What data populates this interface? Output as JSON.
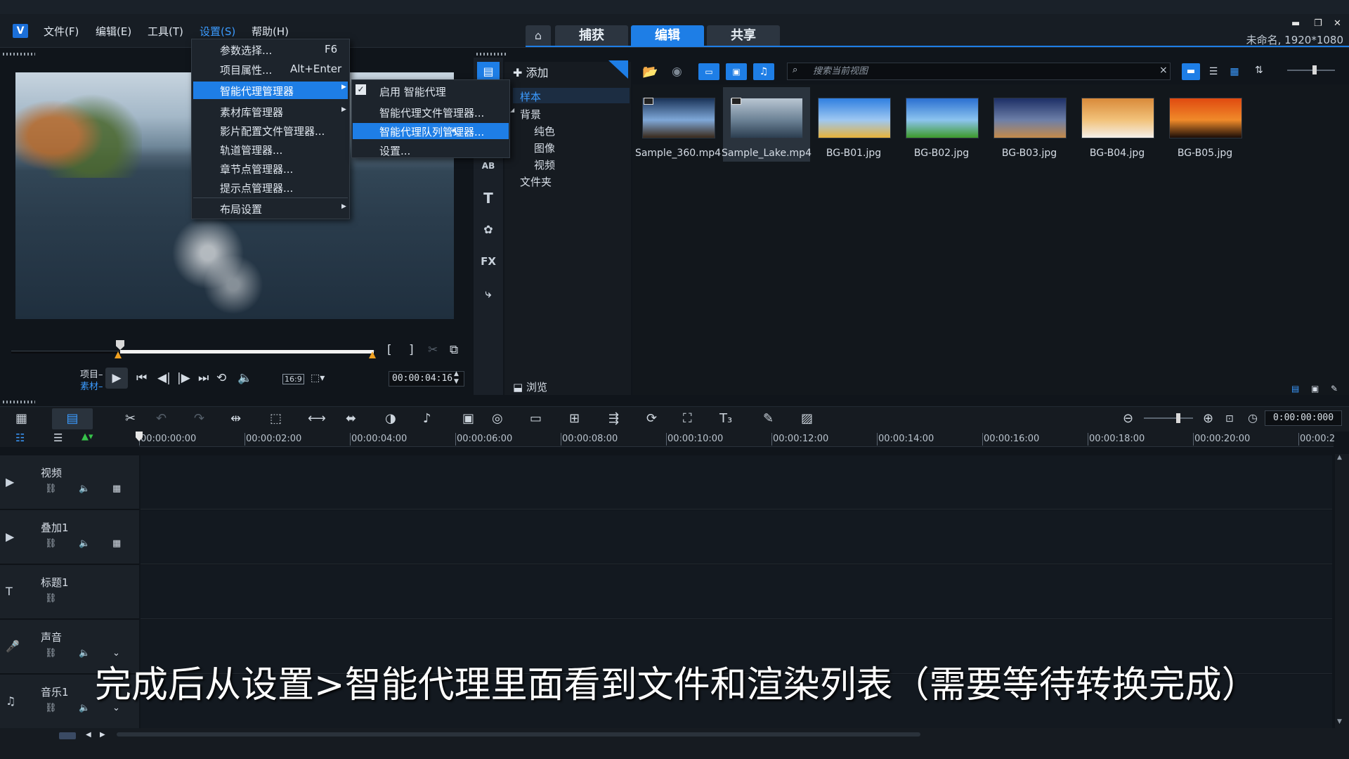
{
  "app": {
    "logo_label": "V",
    "project_info": "未命名, 1920*1080"
  },
  "menubar": {
    "items": [
      {
        "label": "文件(F)"
      },
      {
        "label": "编辑(E)"
      },
      {
        "label": "工具(T)"
      },
      {
        "label": "设置(S)"
      },
      {
        "label": "帮助(H)"
      }
    ]
  },
  "tabs": {
    "home_icon": "home-icon",
    "capture": "捕获",
    "edit": "编辑",
    "share": "共享",
    "active": "编辑"
  },
  "window_controls": {
    "minimize": "▬",
    "restore": "❐",
    "close": "✕"
  },
  "settings_menu": {
    "items": [
      {
        "label": "参数选择...",
        "shortcut": "F6"
      },
      {
        "label": "项目属性...",
        "shortcut": "Alt+Enter"
      },
      {
        "label": "智能代理管理器",
        "submenu": true,
        "highlighted": true
      },
      {
        "label": "素材库管理器",
        "submenu": true
      },
      {
        "label": "影片配置文件管理器..."
      },
      {
        "label": "轨道管理器..."
      },
      {
        "label": "章节点管理器..."
      },
      {
        "label": "提示点管理器..."
      },
      {
        "label": "布局设置",
        "submenu": true
      }
    ]
  },
  "proxy_submenu": {
    "items": [
      {
        "label": "启用 智能代理",
        "checked": true
      },
      {
        "label": "智能代理文件管理器..."
      },
      {
        "label": "智能代理队列管理器...",
        "highlighted": true
      },
      {
        "label": "设置..."
      }
    ]
  },
  "player": {
    "project_label": "项目",
    "clip_label": "素材",
    "aspect": "16:9",
    "timecode": "00:00:04:16",
    "in_mark": "[",
    "out_mark": "]"
  },
  "library": {
    "add_label": "添加",
    "tree": [
      {
        "label": "样本",
        "level": 0,
        "selected": true
      },
      {
        "label": "背景",
        "level": 0,
        "expander": "◢"
      },
      {
        "label": "纯色",
        "level": 1
      },
      {
        "label": "图像",
        "level": 1
      },
      {
        "label": "视频",
        "level": 1
      },
      {
        "label": "文件夹",
        "level": 0
      }
    ],
    "browse_label": "浏览",
    "search_placeholder": "搜索当前视图",
    "search_clear": "×",
    "items": [
      {
        "label": "Sample_360.mp4",
        "colors": [
          "#1a3358",
          "#7fa8d8",
          "#3a2a1a"
        ]
      },
      {
        "label": "Sample_Lake.mp4",
        "colors": [
          "#b9c6d2",
          "#6c8296",
          "#2c3e50"
        ],
        "selected": true
      },
      {
        "label": "BG-B01.jpg",
        "colors": [
          "#2f7fe0",
          "#9ec8f2",
          "#e7b23a"
        ]
      },
      {
        "label": "BG-B02.jpg",
        "colors": [
          "#2a6fd0",
          "#8cc4ef",
          "#3d9a2a"
        ]
      },
      {
        "label": "BG-B03.jpg",
        "colors": [
          "#1d2f66",
          "#6d7fa8",
          "#c48a4a"
        ]
      },
      {
        "label": "BG-B04.jpg",
        "colors": [
          "#d98a3a",
          "#f2c27a",
          "#f4efe9"
        ]
      },
      {
        "label": "BG-B05.jpg",
        "colors": [
          "#e04a10",
          "#f08a2a",
          "#1a0d08"
        ]
      }
    ],
    "sidebar_icons": [
      "media-icon",
      "instant-project-icon",
      "transition-icon",
      "title-icon",
      "graphics-icon",
      "filter-icon",
      "path-icon"
    ]
  },
  "timeline": {
    "timecode": "0:00:00:000",
    "ruler": [
      "00:00:00:00",
      "00:00:02:00",
      "00:00:04:00",
      "00:00:06:00",
      "00:00:08:00",
      "00:00:10:00",
      "00:00:12:00",
      "00:00:14:00",
      "00:00:16:00",
      "00:00:18:00",
      "00:00:20:00",
      "00:00:2"
    ],
    "tracks": [
      {
        "name": "视频",
        "icon": "video-track-icon"
      },
      {
        "name": "叠加1",
        "icon": "overlay-track-icon"
      },
      {
        "name": "标题1",
        "icon": "title-track-icon"
      },
      {
        "name": "声音",
        "icon": "voice-track-icon"
      },
      {
        "name": "音乐1",
        "icon": "music-track-icon"
      }
    ]
  },
  "subtitle": "完成后从设置>智能代理里面看到文件和渲染列表（需要等待转换完成）"
}
